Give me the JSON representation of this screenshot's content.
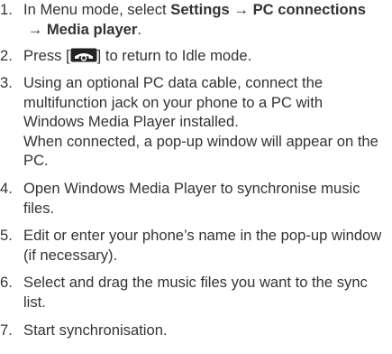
{
  "steps": [
    {
      "number": "1.",
      "parts": {
        "t1": "In Menu mode, select ",
        "b1": "Settings",
        "arrow1": " → ",
        "b2": "PC connections",
        "arrow2": " → ",
        "b3": "Media player",
        "t2": "."
      }
    },
    {
      "number": "2.",
      "parts": {
        "t1": "Press [",
        "key_icon": "end-call-key-icon",
        "t2": "] to return to Idle mode."
      }
    },
    {
      "number": "3.",
      "text": "Using an optional PC data cable, connect the multifunction jack on your phone to a PC with Windows Media Player installed.",
      "note": "When connected, a pop-up window will appear on the PC."
    },
    {
      "number": "4.",
      "text": "Open Windows Media Player to synchronise music files."
    },
    {
      "number": "5.",
      "text": "Edit or enter your phone’s name in the pop-up window (if necessary)."
    },
    {
      "number": "6.",
      "text": "Select and drag the music files you want to the sync list."
    },
    {
      "number": "7.",
      "text": "Start synchronisation."
    }
  ]
}
